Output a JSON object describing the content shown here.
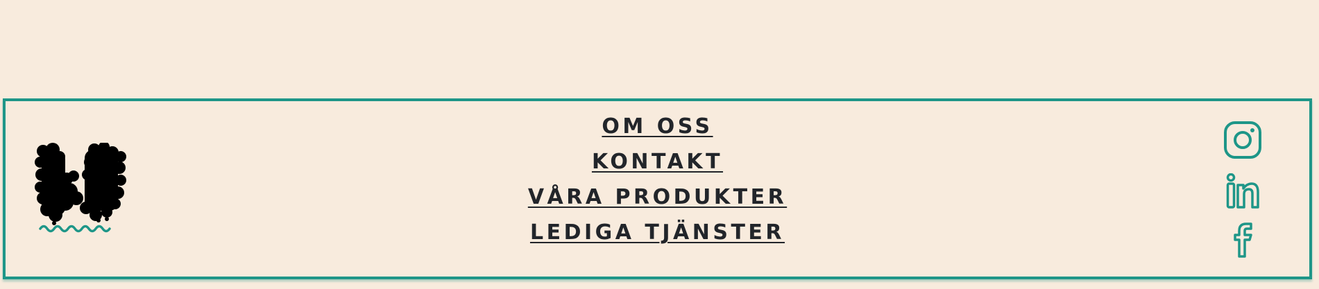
{
  "footer": {
    "border_color": "#1e9688",
    "background": "#f8ebdd",
    "logo": {
      "icon": "brand-logo-icon",
      "fill": "#000000",
      "wave_color": "#1e9688"
    },
    "nav": [
      {
        "label": "OM OSS"
      },
      {
        "label": "KONTAKT"
      },
      {
        "label": "VÅRA PRODUKTER"
      },
      {
        "label": "LEDIGA TJÄNSTER"
      }
    ],
    "social": [
      {
        "icon": "instagram-icon"
      },
      {
        "icon": "linkedin-icon"
      },
      {
        "icon": "facebook-icon"
      }
    ]
  }
}
